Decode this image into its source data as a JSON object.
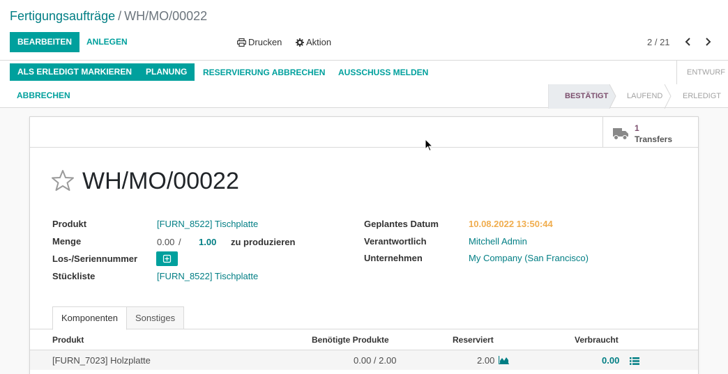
{
  "breadcrumb": {
    "parent": "Fertigungsaufträge",
    "separator": "/",
    "current": "WH/MO/00022"
  },
  "toolbar": {
    "edit_label": "Bearbeiten",
    "create_label": "Anlegen",
    "print_label": "Drucken",
    "action_label": "Aktion"
  },
  "pager": {
    "value": "2 / 21"
  },
  "header_buttons": {
    "mark_done": "Als erledigt markieren",
    "planning": "Planung",
    "cancel_reservation": "Reservierung abbrechen",
    "report_scrap": "Ausschuss melden",
    "cancel": "Abbrechen"
  },
  "status": {
    "draft": "Entwurf",
    "confirmed": "Bestätigt",
    "in_progress": "Laufend",
    "done": "Erledigt",
    "active": "confirmed"
  },
  "smart_button": {
    "count": "1",
    "label": "Transfers",
    "icon": "truck-icon"
  },
  "record": {
    "name": "WH/MO/00022"
  },
  "fields": {
    "product_label": "Produkt",
    "product_value": "[FURN_8522] Tischplatte",
    "quantity_label": "Menge",
    "qty_produced": "0.00",
    "qty_sep": "/",
    "qty_to_produce": "1.00",
    "qty_suffix": "zu produzieren",
    "lot_label": "Los-/Seriennummer",
    "bom_label": "Stückliste",
    "bom_value": "[FURN_8522] Tischplatte",
    "planned_date_label": "Geplantes Datum",
    "planned_date_value": "10.08.2022 13:50:44",
    "responsible_label": "Verantwortlich",
    "responsible_value": "Mitchell Admin",
    "company_label": "Unternehmen",
    "company_value": "My Company (San Francisco)"
  },
  "tabs": {
    "components": "Komponenten",
    "misc": "Sonstiges"
  },
  "table": {
    "headers": {
      "product": "Produkt",
      "needed": "Benötigte Produkte",
      "reserved": "Reserviert",
      "consumed": "Verbraucht"
    },
    "rows": [
      {
        "product": "[FURN_7023] Holzplatte",
        "needed": "0.00 / 2.00",
        "reserved": "2.00",
        "consumed": "0.00"
      }
    ]
  },
  "colors": {
    "primary": "#00a09d",
    "link": "#017e84",
    "accent": "#7c4f6e",
    "warning": "#f0ad4e"
  }
}
